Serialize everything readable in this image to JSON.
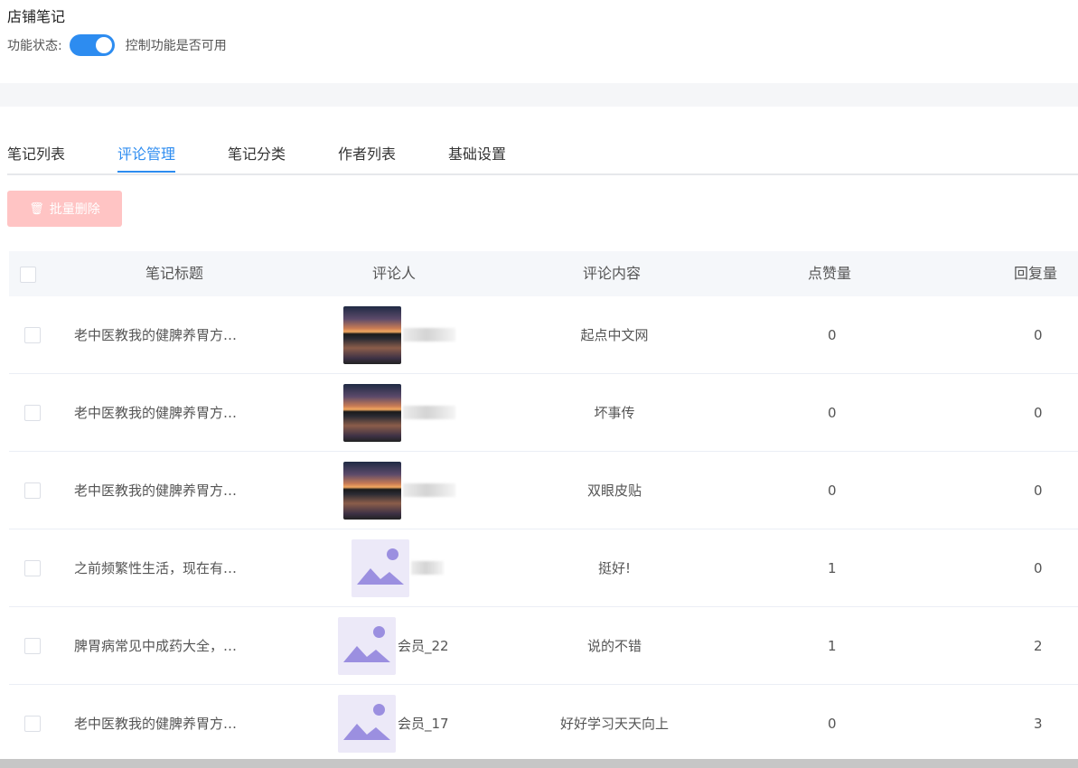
{
  "page": {
    "title": "店铺笔记"
  },
  "status": {
    "label": "功能状态:",
    "enabled": true,
    "description": "控制功能是否可用"
  },
  "tabs": [
    {
      "label": "笔记列表",
      "active": false
    },
    {
      "label": "评论管理",
      "active": true
    },
    {
      "label": "笔记分类",
      "active": false
    },
    {
      "label": "作者列表",
      "active": false
    },
    {
      "label": "基础设置",
      "active": false
    }
  ],
  "toolbar": {
    "batch_delete_label": "批量删除"
  },
  "table": {
    "headers": [
      "笔记标题",
      "评论人",
      "评论内容",
      "点赞量",
      "回复量"
    ],
    "rows": [
      {
        "note_title": "老中医教我的健脾养胃方…",
        "commenter_avatar": "photo",
        "commenter_name": "",
        "content": "起点中文网",
        "likes": "0",
        "replies": "0"
      },
      {
        "note_title": "老中医教我的健脾养胃方…",
        "commenter_avatar": "photo",
        "commenter_name": "",
        "content": "坏事传",
        "likes": "0",
        "replies": "0"
      },
      {
        "note_title": "老中医教我的健脾养胃方…",
        "commenter_avatar": "photo",
        "commenter_name": "",
        "content": "双眼皮贴",
        "likes": "0",
        "replies": "0"
      },
      {
        "note_title": "之前频繁性生活，现在有…",
        "commenter_avatar": "placeholder",
        "commenter_name": "",
        "content": "挺好!",
        "likes": "1",
        "replies": "0"
      },
      {
        "note_title": "脾胃病常见中成药大全，…",
        "commenter_avatar": "placeholder",
        "commenter_name": "会员_22",
        "content": "说的不错",
        "likes": "1",
        "replies": "2"
      },
      {
        "note_title": "老中医教我的健脾养胃方…",
        "commenter_avatar": "placeholder",
        "commenter_name": "会员_17",
        "content": "好好学习天天向上",
        "likes": "0",
        "replies": "3"
      }
    ]
  },
  "colors": {
    "accent": "#2d8cf0",
    "danger_disabled": "#ffc4c4",
    "header_bg": "#f5f7fa",
    "placeholder_purple": "#9b8fe0"
  }
}
